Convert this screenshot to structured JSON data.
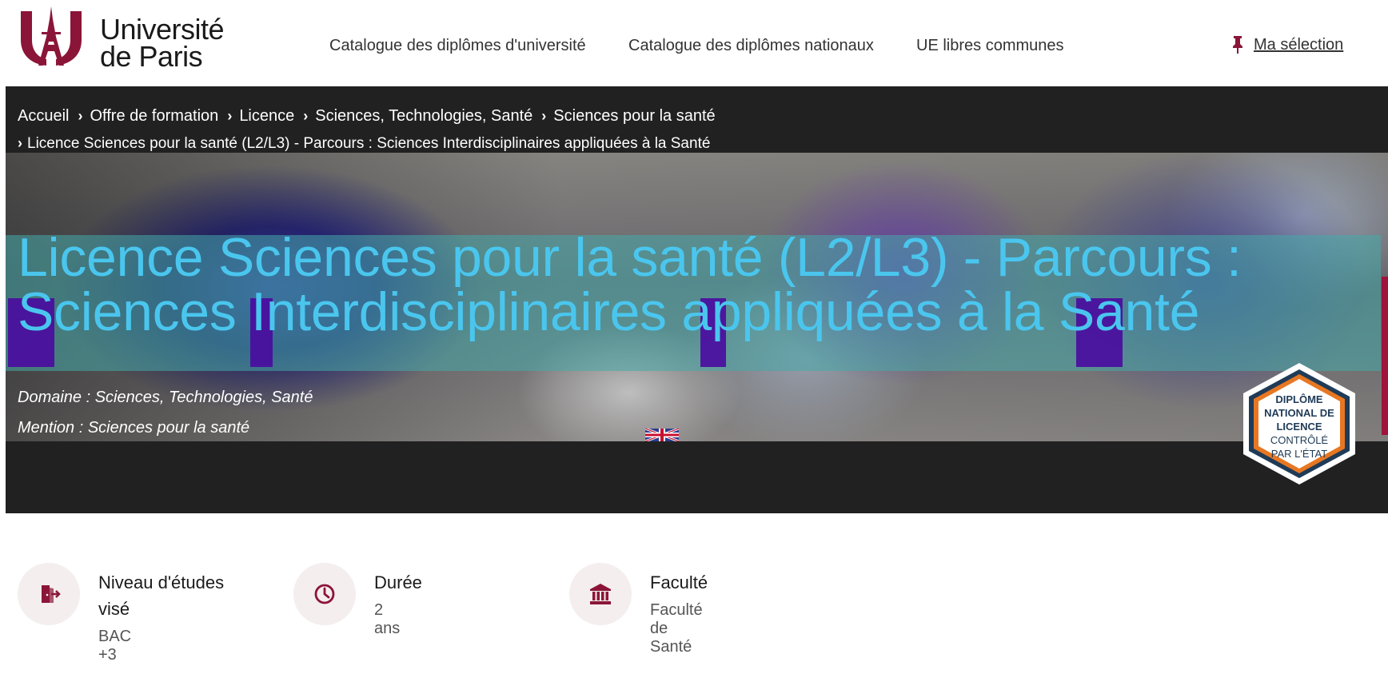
{
  "header": {
    "logo_text_line1": "Université",
    "logo_text_line2": "de Paris",
    "nav": [
      {
        "label": "Catalogue des diplômes d'université"
      },
      {
        "label": "Catalogue des diplômes nationaux"
      },
      {
        "label": "UE libres communes"
      }
    ],
    "my_selection": "Ma sélection"
  },
  "breadcrumb": [
    "Accueil",
    "Offre de formation",
    "Licence",
    "Sciences, Technologies, Santé",
    "Sciences pour la santé",
    "Licence Sciences pour la santé (L2/L3) - Parcours : Sciences Interdisciplinaires appliquées à la Santé"
  ],
  "hero": {
    "title": "Licence Sciences pour la santé (L2/L3) - Parcours : Sciences Interdisciplinaires appliquées à la Santé",
    "domaine": "Domaine : Sciences, Technologies, Santé",
    "mention": "Mention : Sciences pour la santé",
    "badge_lines": [
      "DIPLÔME",
      "NATIONAL DE",
      "LICENCE",
      "CONTRÔLÉ",
      "PAR L'ÉTAT"
    ]
  },
  "info": [
    {
      "label": "Niveau d'études visé",
      "value": "BAC +3",
      "icon": "door-exit-icon"
    },
    {
      "label": "Durée",
      "value": "2 ans",
      "icon": "clock-icon"
    },
    {
      "label": "Faculté",
      "value": "Faculté de Santé",
      "icon": "institution-icon"
    }
  ],
  "colors": {
    "brand": "#8b1538",
    "title": "#4ac6ee",
    "hero_bg": "#212121",
    "badge_orange": "#e87722",
    "badge_navy": "#1f3b57"
  }
}
